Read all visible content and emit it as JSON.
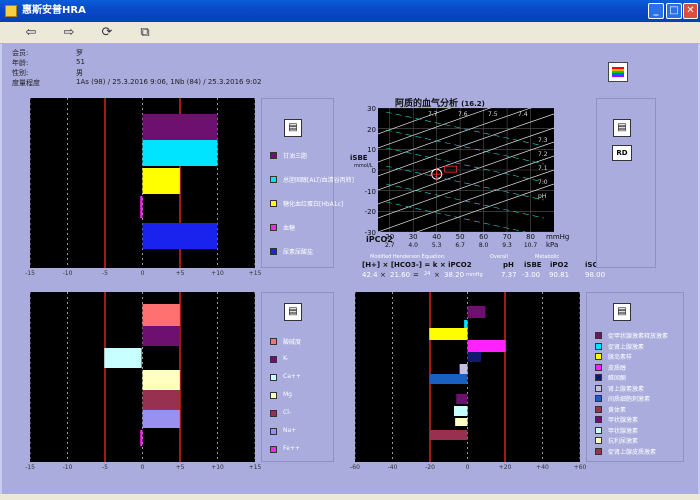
{
  "window": {
    "title": "惠斯安普HRA",
    "minimize": "_",
    "maximize": "□",
    "close": "✕"
  },
  "toolbar": {
    "back_icon": "⇦",
    "forward_icon": "⇨",
    "refresh_icon": "⟳",
    "compare_icon": "⧉"
  },
  "patient": {
    "rows": [
      {
        "label": "会员:",
        "value": "罗"
      },
      {
        "label": "年龄:",
        "value": "51"
      },
      {
        "label": "性别:",
        "value": "男"
      },
      {
        "label": "度量程度",
        "value": "1As (98) / 25.3.2016 9:06, 1Nb (84) / 25.3.2016 9:02"
      }
    ]
  },
  "colors": {
    "magenta": "#ff22ff",
    "cyan": "#00e4ff",
    "yellow": "#ffff00",
    "blue": "#1a22ee",
    "purple": "#6e1070",
    "red": "#c82020"
  },
  "panel1": {
    "axis_ticks": [
      "-15",
      "-10",
      "-5",
      "0",
      "+5",
      "+10",
      "+15"
    ],
    "legend": [
      "甘油三脂",
      "总胆固醇[ALT/血清谷丙转]",
      "糖化血红蛋白[HbA1c]",
      "血糖",
      "尿素尿酸盐"
    ]
  },
  "panel2": {
    "axis_ticks": [
      "-15",
      "-10",
      "-5",
      "0",
      "+5",
      "+10",
      "+15"
    ],
    "legend": [
      "酸碱度",
      "K-",
      "Ca++",
      "Mg",
      "Cl-",
      "Na+",
      "Fe++"
    ]
  },
  "panel3": {
    "axis_ticks": [
      "-60",
      "-40",
      "-20",
      "0",
      "+20",
      "+40",
      "+60"
    ],
    "legend": [
      "促甲状腺激素释放激素",
      "促肾上腺激素",
      "胰岛素样",
      "皮质醇",
      "醛固酮",
      "肾上腺素激素",
      "间质细胞刺激素",
      "黄体素",
      "甲状腺激素",
      "甲状腺激素",
      "抗利尿激素",
      "促肾上腺皮质激素"
    ]
  },
  "abg": {
    "title": "阿质的血气分析",
    "score": "(16.2)",
    "y_label": "iSBE",
    "y_unit": "mmol/L",
    "x_label": "iPCO2",
    "y_ticks": [
      "30",
      "20",
      "10",
      "0",
      "-10",
      "-20",
      "-30"
    ],
    "x_ticks_mmhg": [
      "20",
      "30",
      "40",
      "50",
      "60",
      "70",
      "80"
    ],
    "x_ticks_kpa": [
      "2.7",
      "4.0",
      "5.3",
      "6.7",
      "8.0",
      "9.3",
      "10.7"
    ],
    "x_unit_mmhg": "mmHg",
    "x_unit_kpa": "kPa",
    "ph_labels": [
      "7.7",
      "7.6",
      "7.5",
      "7.4",
      "7.3",
      "7.2",
      "7.1",
      "7.0",
      "pH"
    ],
    "equation_caption": "Modified Henderson Equation:",
    "overall": "Overall",
    "metabolic": "Metabolic",
    "equation": "[H+] × [HCO3-] = k × iPCO2",
    "hdr_ph": "pH",
    "hdr_isbe": "iSBE",
    "hdr_ipo2": "iPO2",
    "hdr_iso2": "iSO2",
    "val_h": "42.4",
    "val_hco3": "21.60",
    "val_k": "24",
    "val_pco2": "38.20",
    "unit_pco2": "mmHg",
    "val_ph": "7.37",
    "val_isbe": "-3.00",
    "val_ipo2": "90.81",
    "val_iso2": "98.00",
    "rd_label": "RD",
    "point": {
      "pco2": 40,
      "sbe": -2
    }
  }
}
